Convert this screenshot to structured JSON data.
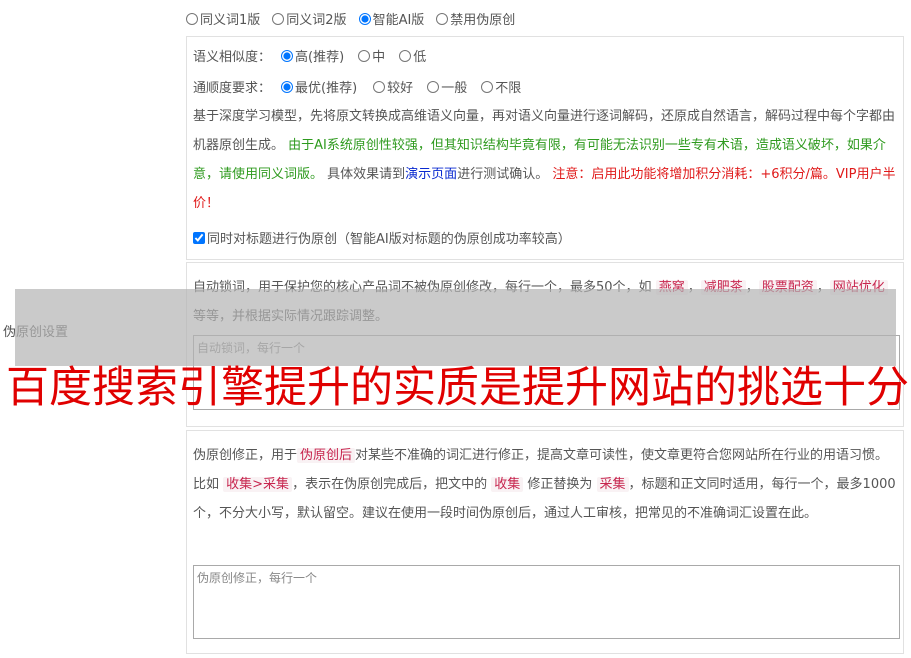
{
  "mode_options": [
    {
      "label": "同义词1版",
      "selected": false
    },
    {
      "label": "同义词2版",
      "selected": false
    },
    {
      "label": "智能AI版",
      "selected": true
    },
    {
      "label": "禁用伪原创",
      "selected": false
    }
  ],
  "settings_label": "伪原创设置",
  "similarity": {
    "label": "语义相似度：",
    "options": [
      {
        "label": "高(推荐)",
        "selected": true
      },
      {
        "label": "中",
        "selected": false
      },
      {
        "label": "低",
        "selected": false
      }
    ]
  },
  "fluency": {
    "label": "通顺度要求：",
    "options": [
      {
        "label": "最优(推荐)",
        "selected": true
      },
      {
        "label": "较好",
        "selected": false
      },
      {
        "label": "一般",
        "selected": false
      },
      {
        "label": "不限",
        "selected": false
      }
    ]
  },
  "ai_desc": {
    "p1": "基于深度学习模型，先将原文转换成高维语义向量，再对语义向量进行逐词解码，还原成自然语言，解码过程中每个字都由机器原创生成。",
    "p2_green": "由于AI系统原创性较强，但其知识结构毕竟有限，有可能无法识别一些专有术语，造成语义破坏，如果介意，请使用同义词版。",
    "p3": "具体效果请到",
    "p3_link": "演示页面",
    "p3_tail": "进行测试确认。",
    "p4_red": "注意：启用此功能将增加积分消耗：+6积分/篇。VIP用户半价！"
  },
  "title_checkbox": {
    "label": "同时对标题进行伪原创（智能AI版对标题的伪原创成功率较高）",
    "checked": true
  },
  "lock_words": {
    "desc_a": "自动锁词，用于保护您的核心产品词不被伪原创修改，每行一个，最多50个，如",
    "examples": [
      "燕窝",
      "减肥茶",
      "股票配资",
      "网站优化"
    ],
    "sep": "，",
    "desc_b": "等等，并根据实际情况跟踪调整。",
    "placeholder": "自动锁词，每行一个"
  },
  "correction": {
    "desc_a": "伪原创修正，用于",
    "tag1": "伪原创后",
    "desc_b": "对某些不准确的词汇进行修正，提高文章可读性，使文章更符合您网站所在行业的用语习惯。比如",
    "tag2": "收集>采集",
    "desc_c": "，表示在伪原创完成后，把文中的",
    "tag3": "收集",
    "desc_d": "修正替换为",
    "tag4": "采集",
    "desc_e": "，标题和正文同时适用，每行一个，最多1000个，不分大小写，默认留空。建议在使用一段时间伪原创后，通过人工审核，把常见的不准确词汇设置在此。",
    "placeholder": "伪原创修正，每行一个"
  },
  "watermark": "百度搜索引擎提升的实质是提升网站的挑选十分",
  "colors": {
    "green": "#2e9a1e",
    "red": "#e01a1a",
    "link": "#0a2ad0",
    "tag": "#c7254e"
  }
}
